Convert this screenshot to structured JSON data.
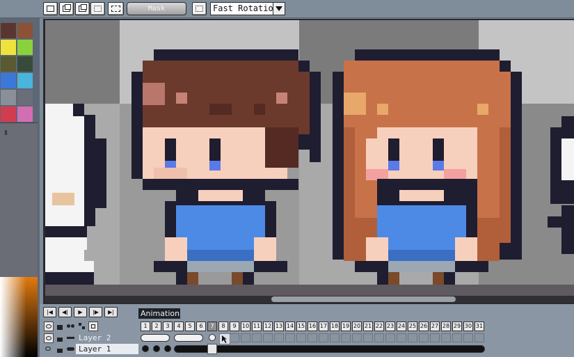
{
  "toolbar": {
    "mask_label": "Mask",
    "rotation_value": "Fast Rotation",
    "buttons": [
      "select-tool-icon",
      "copy-icon",
      "paste-icon",
      "stamp-icon",
      "transform-icon",
      "grid-icon"
    ]
  },
  "palette": {
    "colors": [
      "#5a3630",
      "#8c5238",
      "#f0e23c",
      "#8ad23c",
      "#5a5a32",
      "#384a3a",
      "#3c78d8",
      "#4ab4dc",
      "#8a9098",
      "#6a6e78",
      "#d23c50",
      "#d26eb4"
    ]
  },
  "timeline": {
    "tab_label": "Animation",
    "playback_buttons": [
      "first-frame-icon",
      "prev-frame-icon",
      "play-icon",
      "next-frame-icon",
      "last-frame-icon"
    ],
    "frames": [
      "1",
      "2",
      "3",
      "4",
      "5",
      "6",
      "7",
      "8",
      "9",
      "10",
      "11",
      "12",
      "13",
      "14",
      "15",
      "16",
      "17",
      "18",
      "19",
      "20",
      "21",
      "22",
      "23",
      "24",
      "25",
      "26",
      "27",
      "28",
      "29",
      "30",
      "31"
    ],
    "current_frame": "7",
    "layers": [
      {
        "name": "Layer 2"
      },
      {
        "name": "Layer 1"
      }
    ]
  },
  "colors": {
    "hair_brown": "#6b3a2c",
    "hair_orange": "#c8724a",
    "shirt_blue": "#4d8ae6",
    "outline": "#1f1d30",
    "skin": "#f7d0bd"
  }
}
